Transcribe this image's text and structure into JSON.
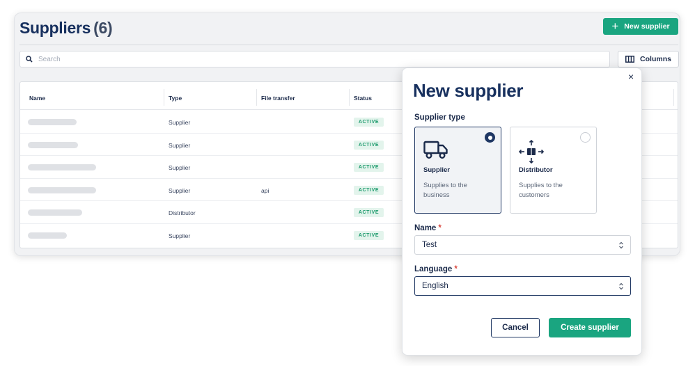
{
  "page": {
    "title": "Suppliers",
    "count": "(6)",
    "new_button_label": "New supplier",
    "search_placeholder": "Search",
    "columns_button_label": "Columns"
  },
  "table": {
    "headers": [
      "Name",
      "Type",
      "File transfer",
      "Status"
    ],
    "rows": [
      {
        "type": "Supplier",
        "file_transfer": "",
        "status": "ACTIVE"
      },
      {
        "type": "Supplier",
        "file_transfer": "",
        "status": "ACTIVE"
      },
      {
        "type": "Supplier",
        "file_transfer": "",
        "status": "ACTIVE"
      },
      {
        "type": "Supplier",
        "file_transfer": "api",
        "status": "ACTIVE"
      },
      {
        "type": "Distributor",
        "file_transfer": "",
        "status": "ACTIVE"
      },
      {
        "type": "Supplier",
        "file_transfer": "",
        "status": "ACTIVE"
      }
    ]
  },
  "modal": {
    "title": "New supplier",
    "supplier_type_label": "Supplier type",
    "options": [
      {
        "title": "Supplier",
        "description": "Supplies to the business",
        "selected": true,
        "icon": "truck-icon"
      },
      {
        "title": "Distributor",
        "description": "Supplies to the customers",
        "selected": false,
        "icon": "distribution-icon"
      }
    ],
    "name_label": "Name",
    "name_value": "Test",
    "language_label": "Language",
    "language_value": "English",
    "required_mark": "*",
    "close_glyph": "×",
    "cancel_label": "Cancel",
    "create_label": "Create supplier"
  },
  "colors": {
    "primary": "#1aa580",
    "navy": "#17305e",
    "active_badge_bg": "#e3f4ec",
    "active_badge_text": "#1c9a6c",
    "required": "#d9453c"
  }
}
